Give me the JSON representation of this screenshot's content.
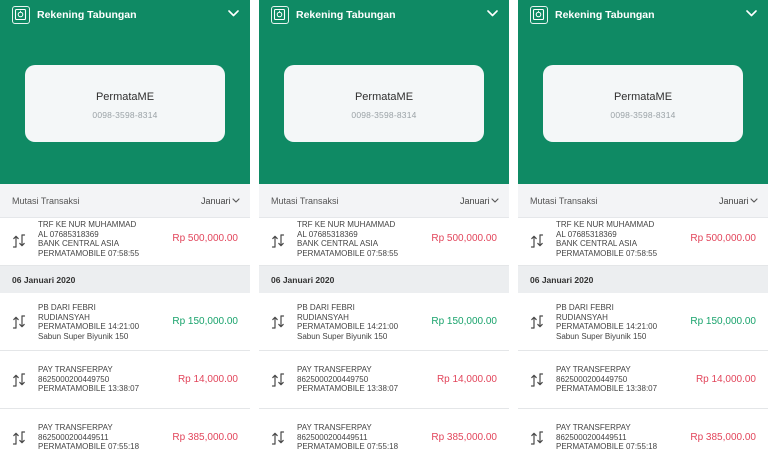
{
  "header": {
    "title": "Rekening Tabungan",
    "icon": "safe-icon",
    "background": "#0f8a64"
  },
  "account": {
    "name": "PermataME",
    "number": "0098-3598-8314"
  },
  "mutasi": {
    "label": "Mutasi Transaksi",
    "month": "Januari"
  },
  "date_header": "06 Januari 2020",
  "transactions": [
    {
      "lines": [
        "TRF KE NUR MUHAMMAD",
        "AL 07685318369",
        "BANK CENTRAL ASIA",
        "PERMATAMOBILE 07:58:55"
      ],
      "amount": "Rp 500,000.00",
      "type": "debit",
      "icon": "transfer-arrows-icon"
    },
    {
      "lines": [
        "PB DARI FEBRI",
        "RUDIANSYAH",
        "PERMATAMOBILE 14:21:00",
        "Sabun Super Biyunik 150"
      ],
      "amount": "Rp 150,000.00",
      "type": "credit",
      "icon": "transfer-arrows-icon"
    },
    {
      "lines": [
        "PAY TRANSFERPAY",
        "8625000200449750",
        "PERMATAMOBILE 13:38:07"
      ],
      "amount": "Rp 14,000.00",
      "type": "debit",
      "icon": "transfer-arrows-icon"
    },
    {
      "lines": [
        "PAY TRANSFERPAY",
        "8625000200449511",
        "PERMATAMOBILE 07:55:18"
      ],
      "amount": "Rp 385,000.00",
      "type": "debit",
      "icon": "transfer-arrows-icon"
    }
  ],
  "colors": {
    "debit": "#e2455b",
    "credit": "#19a36c"
  }
}
